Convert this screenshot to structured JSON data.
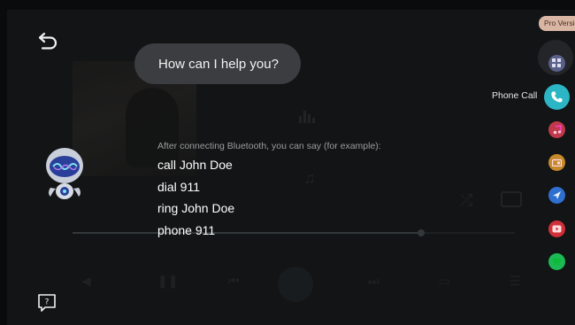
{
  "assistant": {
    "prompt": "How can I help you?",
    "hint": "After connecting Bluetooth, you can say (for example):",
    "examples": [
      "call John Doe",
      "dial 911",
      "ring John Doe",
      "phone 911"
    ]
  },
  "badge": {
    "label": "Pro Versio"
  },
  "rail": {
    "active": {
      "label": "Phone Call",
      "icon": "phone-icon",
      "color": "#2bb5c5"
    },
    "items": [
      {
        "icon": "grid-icon",
        "color": "#5a5f8a"
      },
      {
        "icon": "music-icon",
        "color": "#c0394a"
      },
      {
        "icon": "radio-icon",
        "color": "#c78a2a"
      },
      {
        "icon": "navigation-icon",
        "color": "#2f6fd0"
      },
      {
        "icon": "video-icon",
        "color": "#d0303a"
      },
      {
        "icon": "spotify-icon",
        "color": "#1db954"
      }
    ]
  },
  "colors": {
    "accent": "#2bb5c5",
    "bubble": "#3b3d40",
    "badge": "#d9b6a3"
  }
}
